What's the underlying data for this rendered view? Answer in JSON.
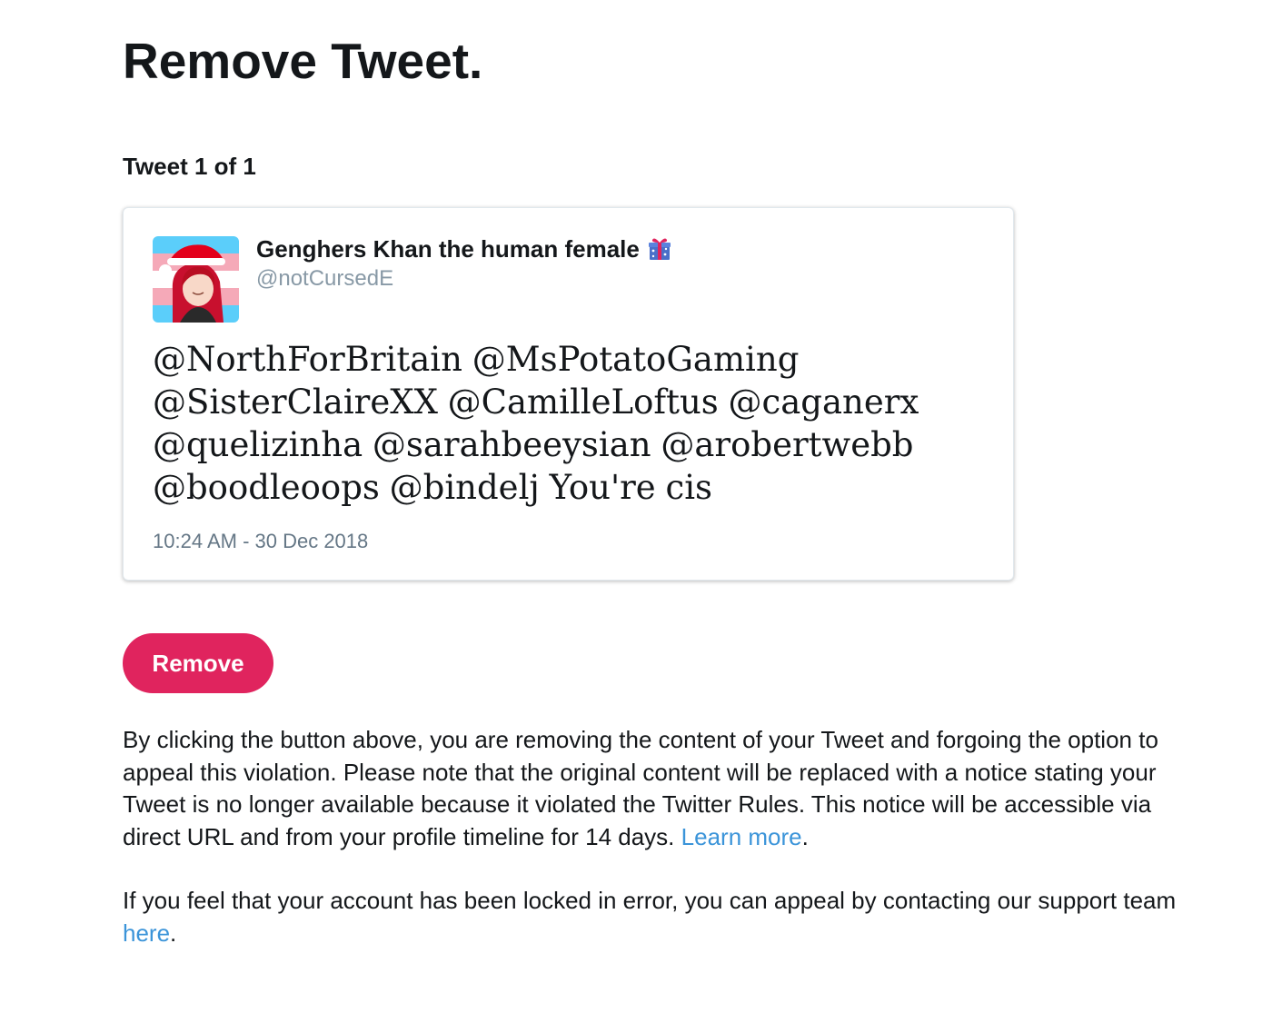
{
  "page": {
    "title": "Remove Tweet.",
    "tweet_counter": "Tweet 1 of 1"
  },
  "tweet": {
    "display_name": "Genghers Khan the human female",
    "handle": "@notCursedE",
    "text": "@NorthForBritain @MsPotatoGaming @SisterClaireXX @CamilleLoftus @caganerx @quelizinha @sarahbeeysian @arobertwebb @boodleoops @bindelj You're cis",
    "timestamp": "10:24 AM - 30 Dec 2018",
    "avatar_icon": "santa-hat-character-avatar",
    "name_emoji_icon": "wrapped-gift-icon"
  },
  "actions": {
    "remove_label": "Remove"
  },
  "notice": {
    "paragraph_1": "By clicking the button above, you are removing the content of your Tweet and forgoing the option to appeal this violation. Please note that the original content will be replaced with a notice stating your Tweet is no longer available because it violated the Twitter Rules. This notice will be accessible via direct URL and from your profile timeline for 14 days.",
    "learn_more_link": "Learn more",
    "paragraph_1_end": ".",
    "paragraph_2": "If you feel that your account has been locked in error, you can appeal by contacting our support team",
    "here_link": "here",
    "paragraph_2_end": "."
  },
  "colors": {
    "remove_button": "#e0245e",
    "link": "#3b94d9",
    "handle_gray": "#8899a6"
  }
}
